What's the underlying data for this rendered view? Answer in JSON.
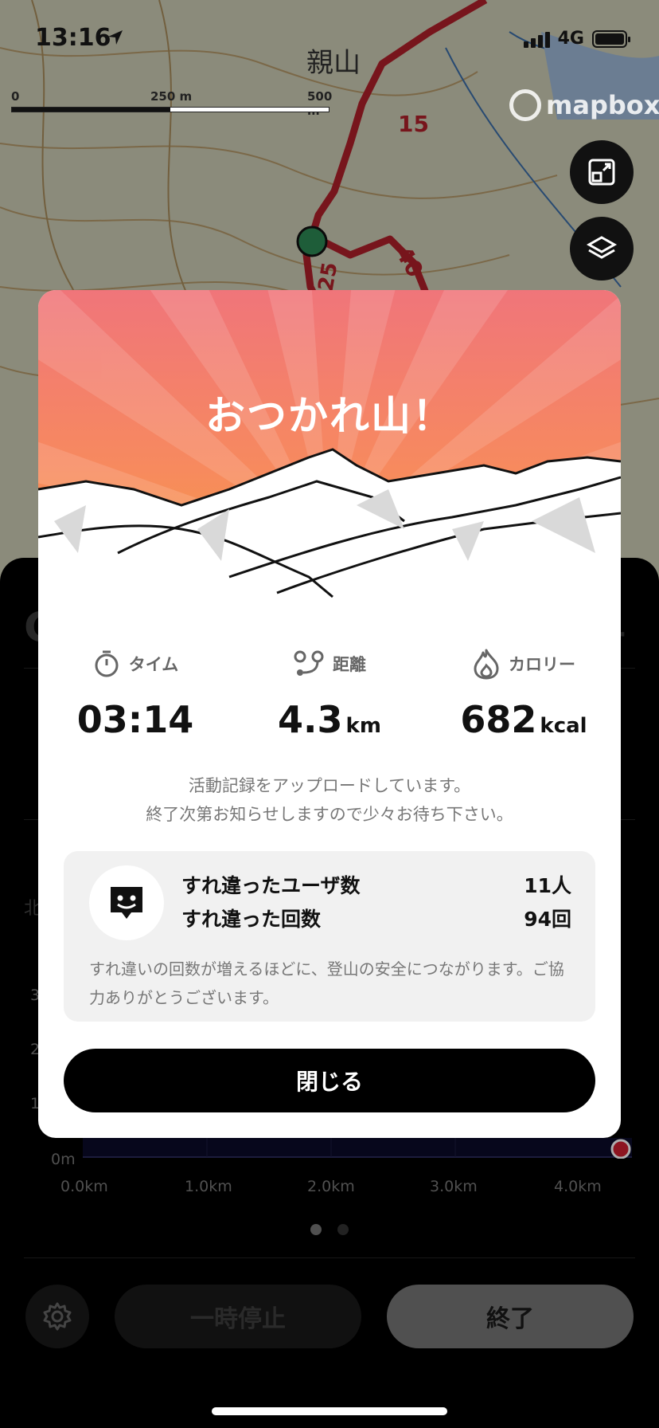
{
  "status_bar": {
    "time": "13:16",
    "network": "4G"
  },
  "map": {
    "scale_labels": [
      "0",
      "250 m",
      "500 m"
    ],
    "place_name": "親山",
    "route_markers": [
      "15",
      "40",
      "25"
    ],
    "attribution": "mapbox",
    "fit_button_icon": "fit-route-icon",
    "layers_button_icon": "layers-icon"
  },
  "modal": {
    "title": "おつかれ山！",
    "stats": [
      {
        "icon": "stopwatch-icon",
        "label": "タイム",
        "value": "03:14",
        "unit": ""
      },
      {
        "icon": "route-icon",
        "label": "距離",
        "value": "4.3",
        "unit": "km"
      },
      {
        "icon": "flame-icon",
        "label": "カロリー",
        "value": "682",
        "unit": "kcal"
      }
    ],
    "upload_message": [
      "活動記録をアップロードしています。",
      "終了次第お知らせしますので少々お待ち下さい。"
    ],
    "passing": {
      "icon": "passing-face-icon",
      "users_label": "すれ違ったユーザ数",
      "users_value": "11人",
      "count_label": "すれ違った回数",
      "count_value": "94回",
      "note": "すれ違いの回数が増えるほどに、登山の安全につながります。ご協力ありがとうございます。"
    },
    "close_label": "閉じる"
  },
  "chart_data": {
    "type": "area",
    "y_ticks": [
      "3",
      "2",
      "1",
      "0m"
    ],
    "x_ticks": [
      "0.0km",
      "1.0km",
      "2.0km",
      "3.0km",
      "4.0km"
    ],
    "current_position_km": 4.3
  },
  "bottom_bar": {
    "settings_icon": "gear-icon",
    "pause_label": "一時停止",
    "end_label": "終了"
  },
  "pager": {
    "pages": 2,
    "active": 1
  }
}
